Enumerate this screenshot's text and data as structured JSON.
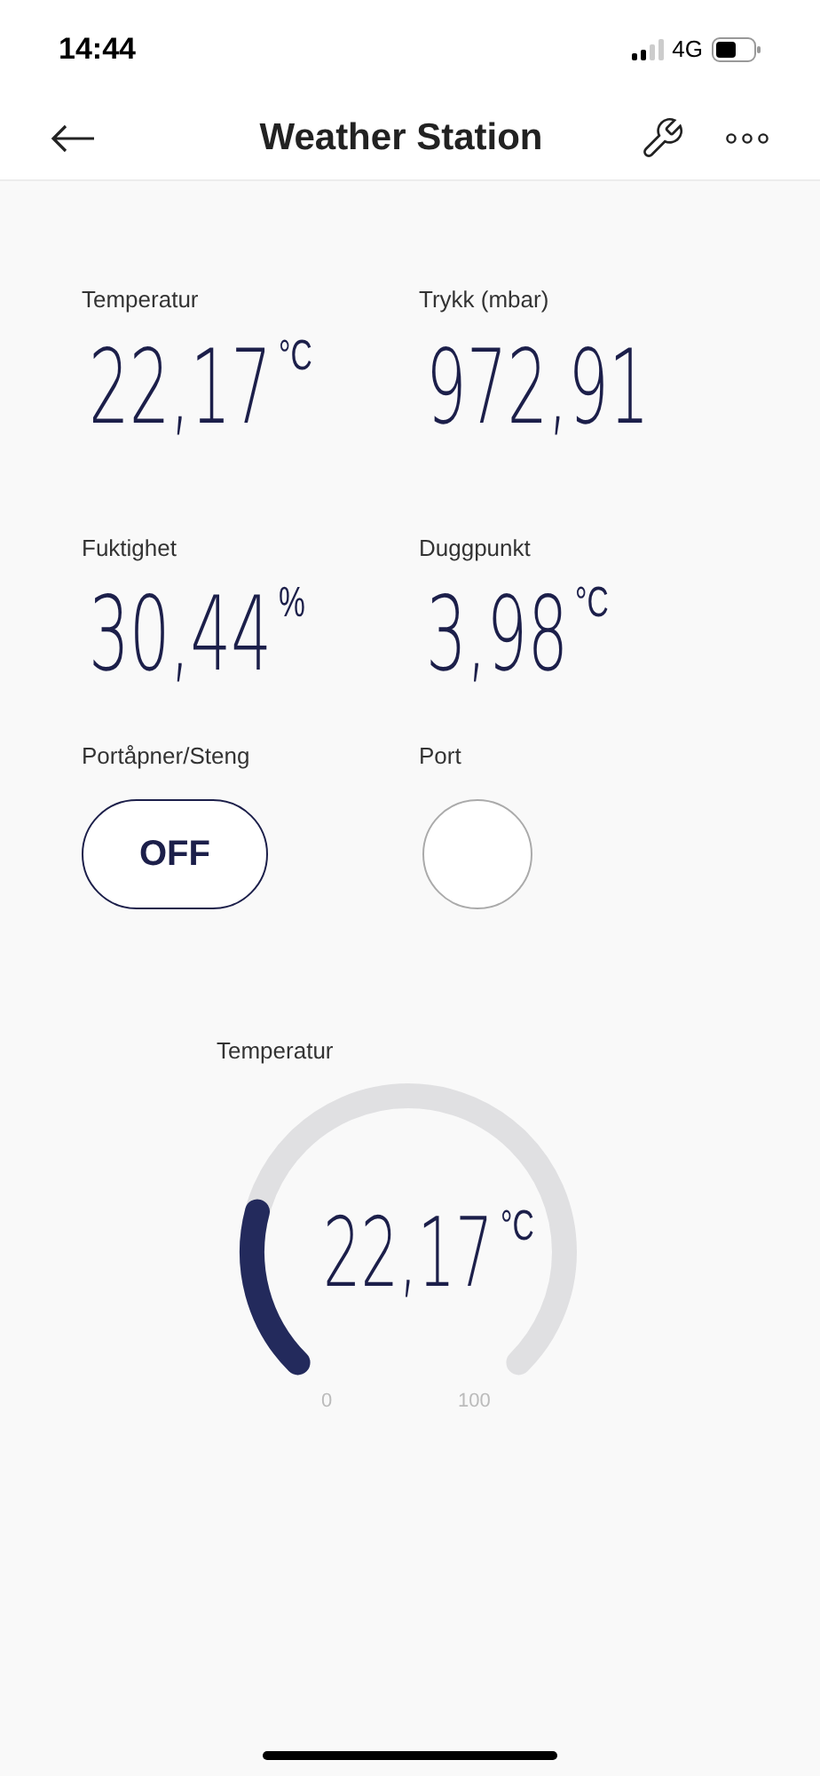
{
  "status_bar": {
    "time": "14:44",
    "network": "4G"
  },
  "nav": {
    "title": "Weather Station"
  },
  "tiles": [
    {
      "label": "Temperatur",
      "value": "22,17",
      "unit": "°C"
    },
    {
      "label": "Trykk (mbar)",
      "value": "972,91"
    },
    {
      "label": "Fuktighet",
      "value": "30,44",
      "unit": "%"
    },
    {
      "label": "Duggpunkt",
      "value": "3,98",
      "unit": "°C"
    }
  ],
  "controls": [
    {
      "kind": "switch",
      "label": "Portåpner/Steng",
      "text": "OFF",
      "on": false
    },
    {
      "kind": "indicator",
      "label": "Port",
      "on": false
    }
  ],
  "gauge": {
    "label": "Temperatur",
    "value": "22,17",
    "unit": "°C",
    "min": "0",
    "max": "100"
  }
}
